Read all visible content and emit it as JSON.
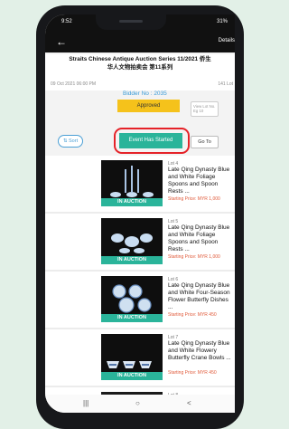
{
  "status_bar": {
    "time": "9:52",
    "icons": "31%"
  },
  "header": {
    "back_icon": "arrow-left-icon",
    "details_label": "Details"
  },
  "auction": {
    "title_line1": "Straits Chinese Antique Auction Series 11/2021 侨生",
    "title_line2": "华人文物拍卖会 第11系列",
    "date_left": "09 Oct 2021 06:00 PM",
    "lot_count": "141 Lot",
    "bidder_no": "Bidder No : 2035",
    "approved_label": "Approved",
    "event_status": "Event Has Started"
  },
  "controls": {
    "sort_label": "Sort",
    "view_lot_placeholder": "View Lot No. Eg 10",
    "goto_label": "Go To"
  },
  "lots": [
    {
      "lot_no": "Lot 4",
      "title": "Late Qing Dynasty Blue and White Foliage Spoons and Spoon Rests ...",
      "price": "Starting Price: MYR 1,000",
      "badge": "IN AUCTION"
    },
    {
      "lot_no": "Lot 5",
      "title": "Late Qing Dynasty Blue and White Foliage Spoons and Spoon Rests ...",
      "price": "Starting Price: MYR 1,000",
      "badge": "IN AUCTION"
    },
    {
      "lot_no": "Lot 6",
      "title": "Late Qing Dynasty Blue and White Four-Season Flower Butterfly Dishes ...",
      "price": "Starting Price: MYR 450",
      "badge": "IN AUCTION"
    },
    {
      "lot_no": "Lot 7",
      "title": "Late Qing Dynasty Blue and White Flowery Butterfly Crane Bowls ...",
      "price": "Starting Price: MYR 450",
      "badge": "IN AUCTION"
    },
    {
      "lot_no": "Lot 8",
      "title": "Late Qing Dynasty Blue and White Four-Season Flower",
      "price": "",
      "badge": ""
    }
  ],
  "nav": {
    "recents_icon": "recents-icon",
    "home_icon": "home-icon",
    "back_icon": "back-icon"
  },
  "colors": {
    "accent_teal": "#2ab49a",
    "approved_yellow": "#f5c21b",
    "highlight_red": "#e52228",
    "link_blue": "#3a9bd8",
    "price_red": "#e05a3a"
  }
}
